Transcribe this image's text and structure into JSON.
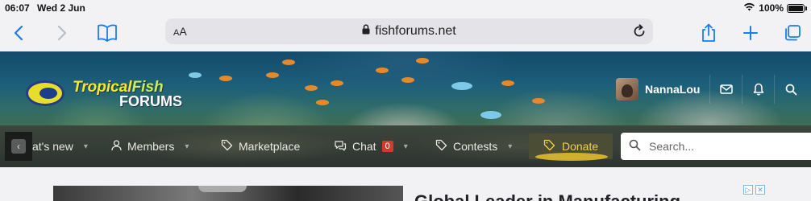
{
  "status_bar": {
    "time": "06:07",
    "date": "Wed 2 Jun",
    "battery": "100%",
    "battery_level": 1.0
  },
  "browser": {
    "reader_label_small": "A",
    "reader_label_large": "A",
    "domain": "fishforums.net",
    "icons": [
      "back-icon",
      "forward-icon",
      "bookmarks-icon",
      "lock-icon",
      "reload-icon",
      "share-icon",
      "new-tab-icon",
      "tabs-icon"
    ]
  },
  "site": {
    "logo_word1": "Tropical",
    "logo_word2": "Fish",
    "logo_word3": "FORUMS",
    "username": "NannaLou",
    "user_icons": [
      "envelope-icon",
      "bell-icon",
      "search-icon"
    ]
  },
  "nav": {
    "scroll_left_glyph": "‹",
    "whats_new": "at's new",
    "members": "Members",
    "marketplace": "Marketplace",
    "chat": "Chat",
    "chat_badge": "0",
    "contests": "Contests",
    "donate": "Donate",
    "search_placeholder": "Search...",
    "caret": "▾"
  },
  "ad": {
    "headline": "Global Leader in Manufacturing",
    "adchoices_1": "▷",
    "adchoices_2": "✕"
  },
  "colors": {
    "safari_blue": "#1a7cf5",
    "donate_yellow": "#f1d24a",
    "badge_red": "#d43a2c"
  }
}
